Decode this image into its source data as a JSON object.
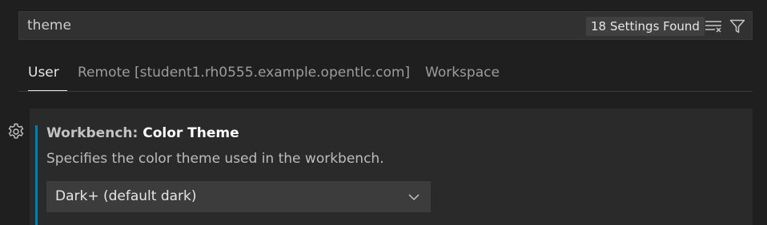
{
  "search": {
    "value": "theme",
    "result_count": "18 Settings Found",
    "clear_icon": "clear-filter-icon",
    "filter_icon": "filter-icon"
  },
  "tabs": [
    {
      "label": "User",
      "active": true
    },
    {
      "label": "Remote [student1.rh0555.example.opentlc.com]",
      "active": false
    },
    {
      "label": "Workspace",
      "active": false
    }
  ],
  "setting": {
    "category": "Workbench: ",
    "name": "Color Theme",
    "description": "Specifies the color theme used in the workbench.",
    "value": "Dark+ (default dark)",
    "gear_icon": "gear-icon",
    "dropdown_icon": "chevron-down-icon"
  },
  "colors": {
    "background": "#1f1f1f",
    "accent": "#0e7aa6",
    "input_bg": "#313131",
    "card_bg": "#2a2a2a"
  }
}
